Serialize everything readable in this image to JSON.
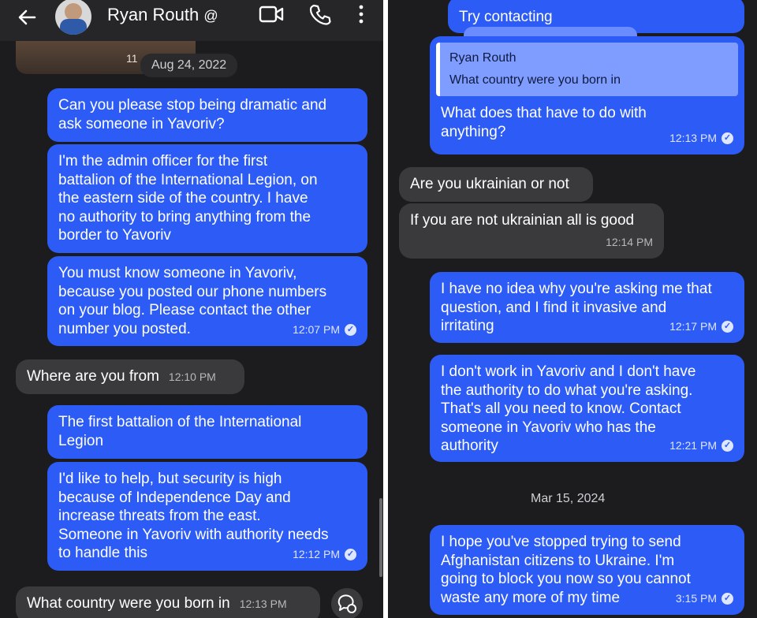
{
  "left": {
    "header": {
      "contact_name": "Ryan Routh",
      "verified_glyph": "@"
    },
    "date_separator": "Aug 24, 2022",
    "partial_time": "11",
    "messages": [
      {
        "dir": "out",
        "text": "Can you please stop being dramatic and\nask someone in Yavoriv?",
        "time": ""
      },
      {
        "dir": "out",
        "text": "I'm the admin officer for the first\nbattalion of the International Legion, on\nthe eastern side of the country. I have\nno authority to bring anything from the\nborder to Yavoriv",
        "time": ""
      },
      {
        "dir": "out",
        "text": "You must know someone in Yavoriv,\nbecause you posted our phone numbers\non your blog. Please contact the other\nnumber you posted.",
        "time": "12:07 PM"
      },
      {
        "dir": "in",
        "text": "Where are you from",
        "time": "12:10 PM"
      },
      {
        "dir": "out",
        "text": "The first battalion of the International\nLegion",
        "time": ""
      },
      {
        "dir": "out",
        "text": "I'd like to help, but security is high\nbecause of Independence Day and\nincrease threats from the east.\nSomeone in Yavoriv with authority needs\nto handle this",
        "time": "12:12 PM"
      },
      {
        "dir": "in",
        "text": "What country were you born in",
        "time": "12:13 PM"
      }
    ]
  },
  "right": {
    "top_partial_text": "Try contacting",
    "quote": {
      "author": "Ryan Routh",
      "text": "What country were you born in"
    },
    "messages": [
      {
        "dir": "out",
        "text": "What does that have to do with\nanything?",
        "time": "12:13 PM"
      },
      {
        "dir": "in",
        "text": "Are you ukrainian or not",
        "time": ""
      },
      {
        "dir": "in",
        "text": "If you are not ukrainian all is good",
        "time": "12:14 PM"
      },
      {
        "dir": "out",
        "text": "I have no idea why you're asking me that\nquestion, and I find it invasive and\nirritating",
        "time": "12:17 PM"
      },
      {
        "dir": "out",
        "text": "I don't work in Yavoriv and I don't have\nthe authority to do what you're asking.\nThat's all you need to know. Contact\nsomeone in Yavoriv who has the\nauthority",
        "time": "12:21 PM"
      },
      {
        "dir": "out",
        "text": "I hope you've stopped trying to send\nAfghanistan citizens to Ukraine. I'm\ngoing to block you now so you cannot\nwaste any more of my time",
        "time": "3:15 PM"
      }
    ],
    "date_separator": "Mar 15, 2024"
  },
  "icons": {
    "back": "back-arrow-icon",
    "video": "video-call-icon",
    "phone": "phone-icon",
    "more": "more-options-icon",
    "read": "read-receipt-icon",
    "react": "reaction-icon"
  }
}
